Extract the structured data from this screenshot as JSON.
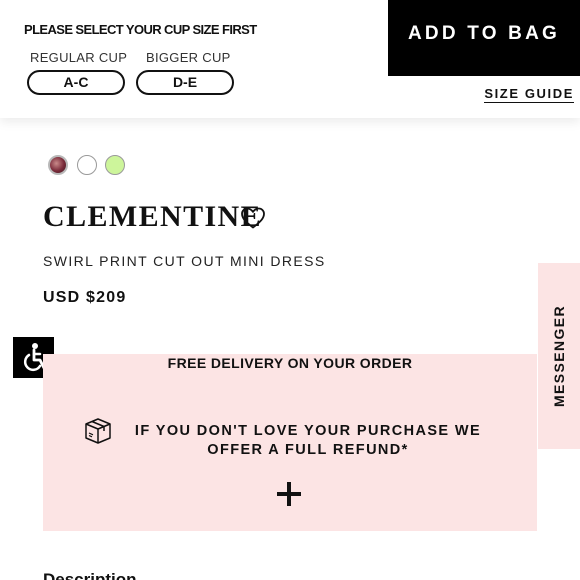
{
  "cup": {
    "title": "PLEASE SELECT YOUR CUP SIZE FIRST",
    "options": [
      {
        "label": "REGULAR CUP",
        "size": "A-C"
      },
      {
        "label": "BIGGER CUP",
        "size": "D-E"
      }
    ]
  },
  "actions": {
    "add_to_bag": "ADD TO BAG",
    "size_guide": "SIZE GUIDE"
  },
  "swatches": [
    {
      "name": "swirl-print",
      "color": "#7a2b3a"
    },
    {
      "name": "white",
      "color": "#ffffff"
    },
    {
      "name": "lime",
      "color": "#cdf59b"
    }
  ],
  "product": {
    "name": "CLEMENTINE",
    "subtitle": "SWIRL PRINT CUT OUT MINI DRESS",
    "price": "USD $209"
  },
  "delivery": {
    "title": "FREE DELIVERY ON YOUR ORDER",
    "refund_text": "IF YOU DON'T LOVE YOUR PURCHASE WE OFFER A FULL REFUND*"
  },
  "messenger_label": "MESSENGER",
  "description_heading": "Description",
  "colors": {
    "accent_pink": "#fce4e4",
    "button_black": "#000000"
  },
  "icons": [
    "heart-icon",
    "accessibility-icon",
    "box-icon",
    "plus-icon"
  ]
}
